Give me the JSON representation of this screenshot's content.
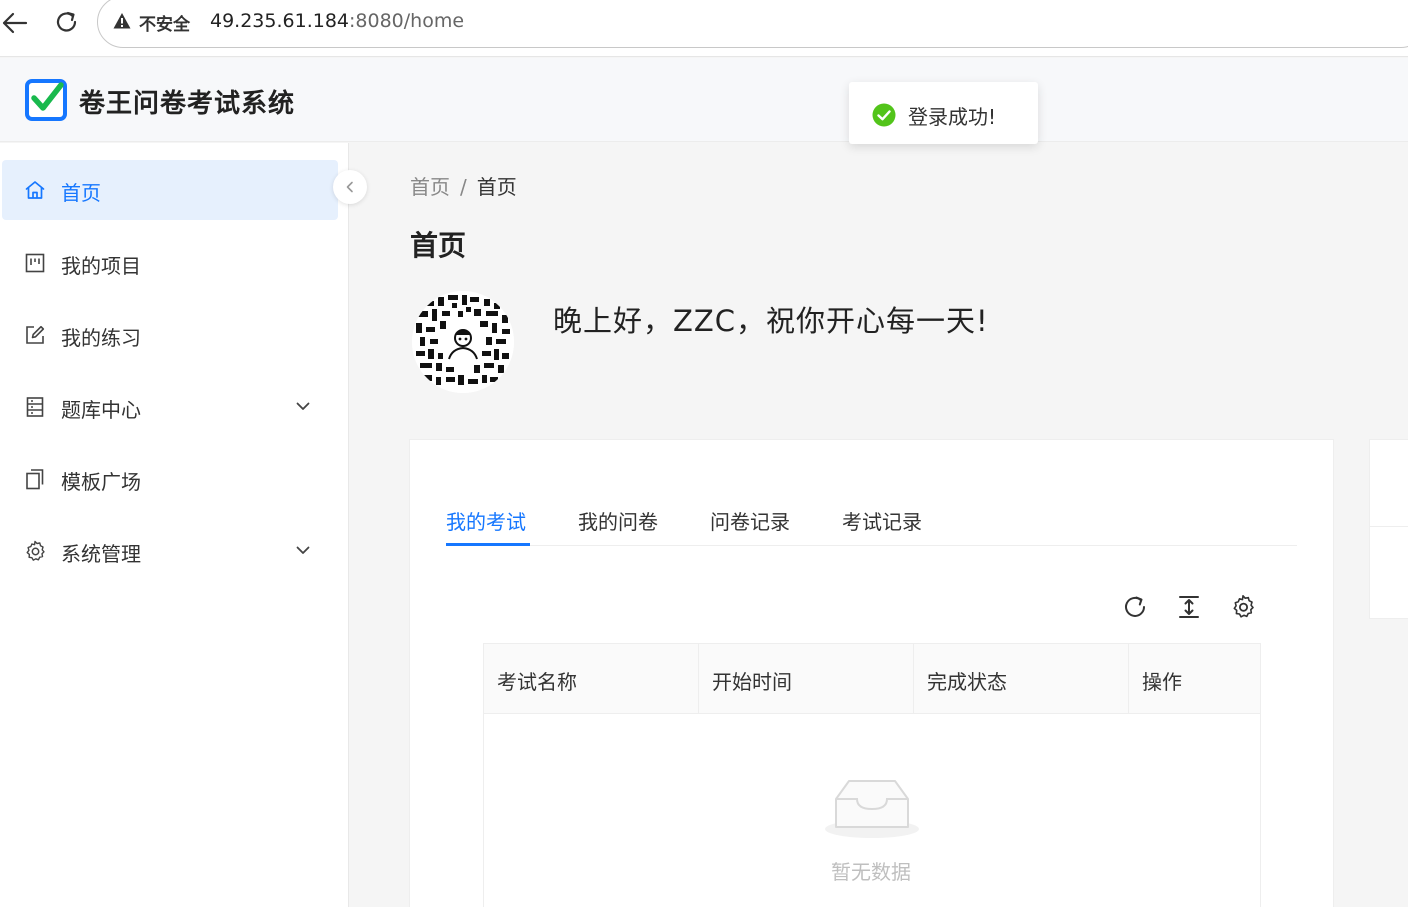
{
  "browser": {
    "insecure_label": "不安全",
    "url_host": "49.235.61.184",
    "url_rest": ":8080/home"
  },
  "app": {
    "title": "卷王问卷考试系统",
    "brand_color": "#1677ff"
  },
  "toast": {
    "message": "登录成功!",
    "icon": "check-circle-icon",
    "color": "#52c41a"
  },
  "sidebar": {
    "items": [
      {
        "label": "首页",
        "icon": "home-icon",
        "active": true
      },
      {
        "label": "我的项目",
        "icon": "project-icon"
      },
      {
        "label": "我的练习",
        "icon": "edit-icon"
      },
      {
        "label": "题库中心",
        "icon": "list-icon",
        "expandable": true
      },
      {
        "label": "模板广场",
        "icon": "copy-icon"
      },
      {
        "label": "系统管理",
        "icon": "gear-icon",
        "expandable": true
      }
    ]
  },
  "breadcrumb": {
    "root": "首页",
    "separator": "/",
    "current": "首页"
  },
  "page": {
    "title": "首页",
    "greeting": "晚上好，ZZC，祝你开心每一天!"
  },
  "tabs": [
    "我的考试",
    "我的问卷",
    "问卷记录",
    "考试记录"
  ],
  "table": {
    "columns": [
      "考试名称",
      "开始时间",
      "完成状态",
      "操作"
    ],
    "empty_text": "暂无数据"
  }
}
